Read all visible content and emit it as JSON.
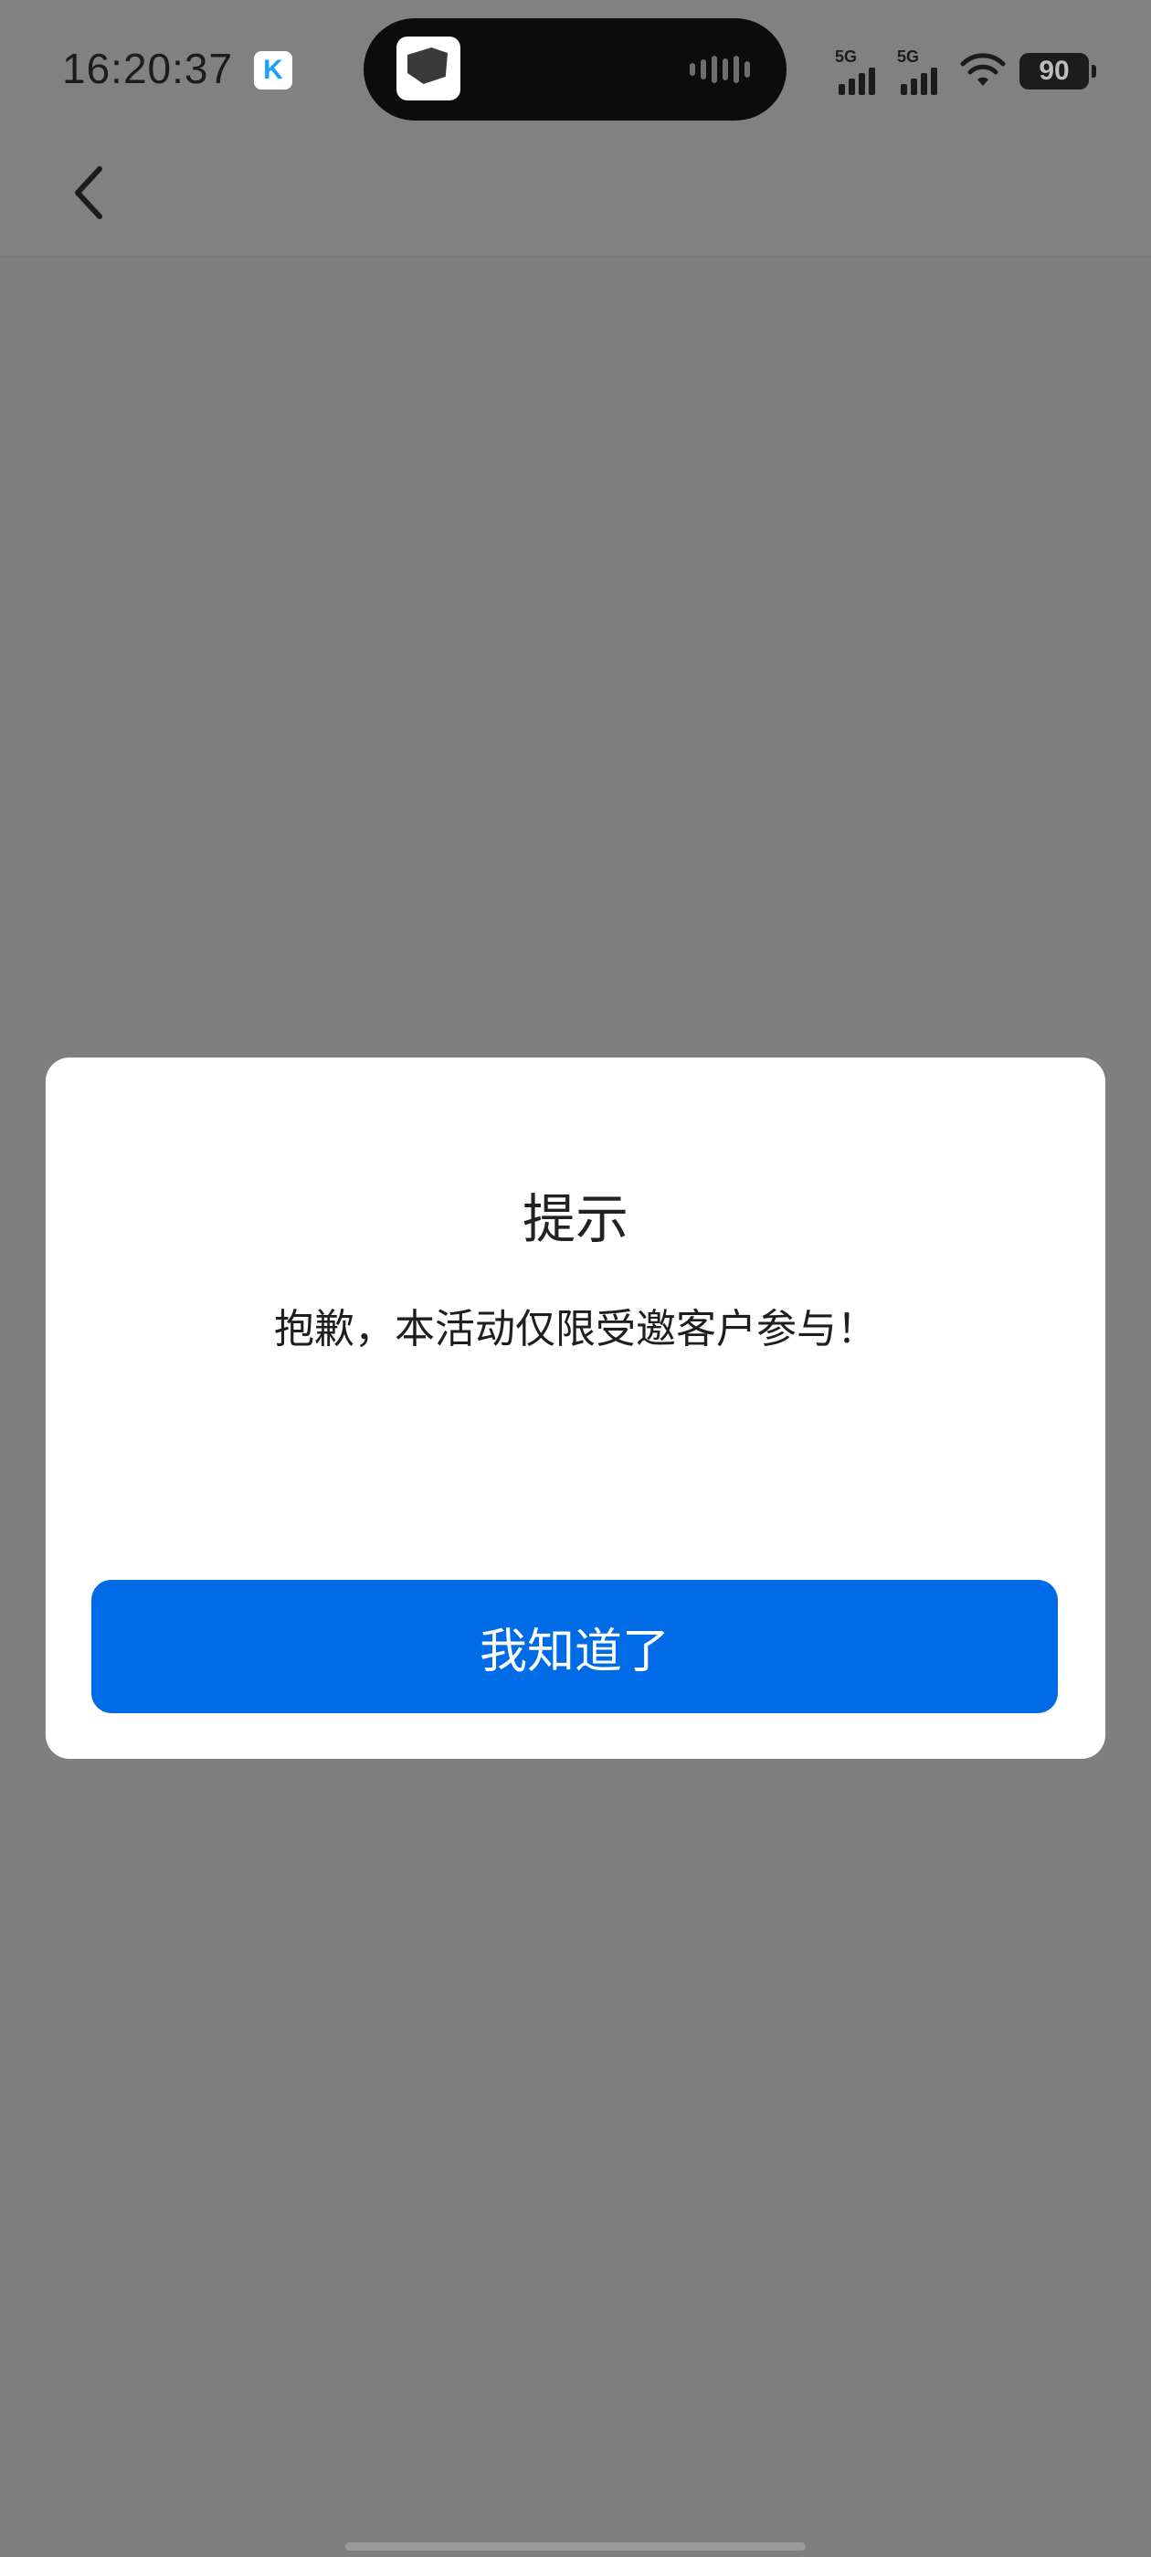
{
  "status_bar": {
    "time": "16:20:37",
    "app_badge_letter": "K",
    "network_1": "5G",
    "network_2": "5G",
    "battery_level": "90"
  },
  "nav": {
    "back_icon": "chevron-left-icon"
  },
  "dialog": {
    "title": "提示",
    "message": "抱歉，本活动仅限受邀客户参与！",
    "confirm_label": "我知道了"
  },
  "colors": {
    "overlay": "#7f7f7f",
    "dialog_bg": "#ffffff",
    "primary_button": "#006be6",
    "button_text": "#ffffff"
  }
}
